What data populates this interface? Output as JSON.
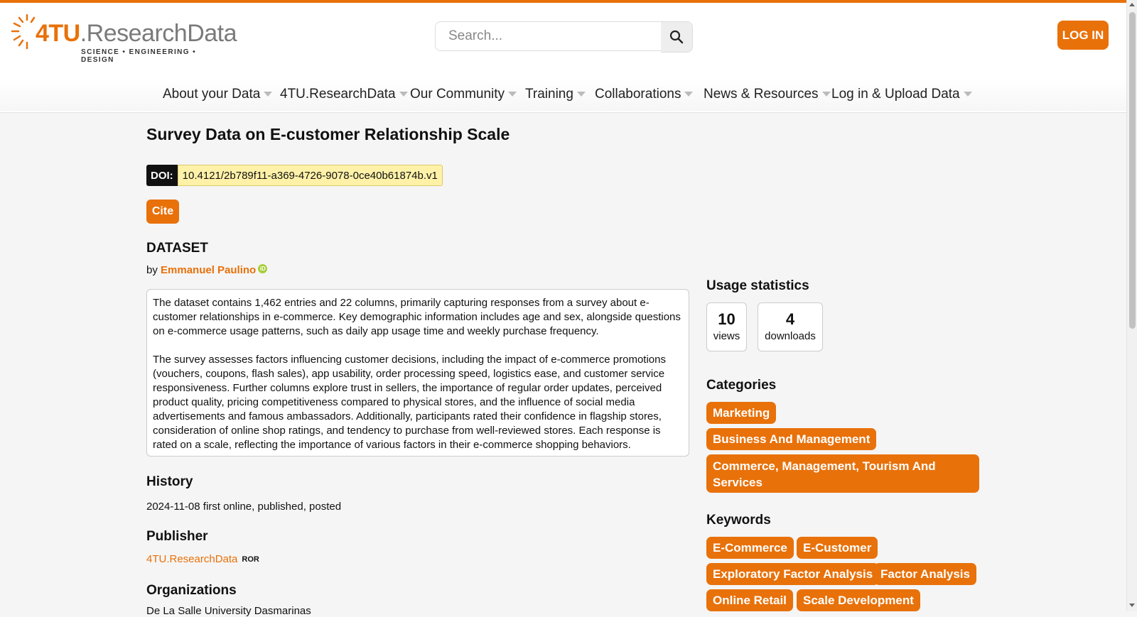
{
  "brand": {
    "logo_main": "4TU",
    "logo_rest": ".ResearchData",
    "logo_sub": "SCIENCE • ENGINEERING • DESIGN",
    "accent": "#e8710a"
  },
  "search": {
    "placeholder": "Search...",
    "icon": "search-icon"
  },
  "header": {
    "login_label": "LOG IN"
  },
  "nav": [
    "About your Data",
    "4TU.ResearchData",
    "Our Community",
    "Training",
    "Collaborations",
    "News & Resources",
    "Log in & Upload Data"
  ],
  "dataset": {
    "title": "Survey Data on E-customer Relationship Scale",
    "doi_label": "DOI:",
    "doi": "10.4121/2b789f11-a369-4726-9078-0ce40b61874b.v1",
    "cite_label": "Cite",
    "type": "DATASET",
    "by": "by",
    "author": "Emmanuel Paulino",
    "orcid_badge": "iD",
    "description": [
      "The dataset contains 1,462 entries and 22 columns, primarily capturing responses from a survey about e-customer relationships in e-commerce. Key demographic information includes age and sex, alongside questions on e-commerce usage patterns, such as daily app usage time and weekly purchase frequency.",
      "The survey assesses factors influencing customer decisions, including the impact of e-commerce promotions (vouchers, coupons, flash sales), app usability, order processing speed, logistics ease, and customer service responsiveness. Further columns explore trust in sellers, the importance of regular order updates, perceived product quality, pricing competitiveness compared to physical stores, and the influence of social media advertisements and famous ambassadors. Additionally, participants rated their confidence in flagship stores, consideration of online shop ratings, and tendency to purchase from well-reviewed stores. Each response is rated on a scale, reflecting the importance of various factors in their e-commerce shopping behaviors."
    ],
    "history_heading": "History",
    "history": "2024-11-08 first online, published, posted",
    "publisher_heading": "Publisher",
    "publisher": "4TU.ResearchData",
    "ror": "ROR",
    "organizations_heading": "Organizations",
    "organization": "De La Salle University Dasmarinas"
  },
  "usage": {
    "heading": "Usage statistics",
    "views": "10",
    "views_label": "views",
    "downloads": "4",
    "downloads_label": "downloads"
  },
  "categories": {
    "heading": "Categories",
    "items": [
      "Marketing",
      "Business And Management",
      "Commerce, Management, Tourism And Services"
    ]
  },
  "keywords": {
    "heading": "Keywords",
    "items": [
      "E-Commerce",
      "E-Customer",
      "Exploratory Factor Analysis",
      "Factor Analysis",
      "Online Retail",
      "Scale Development"
    ]
  }
}
